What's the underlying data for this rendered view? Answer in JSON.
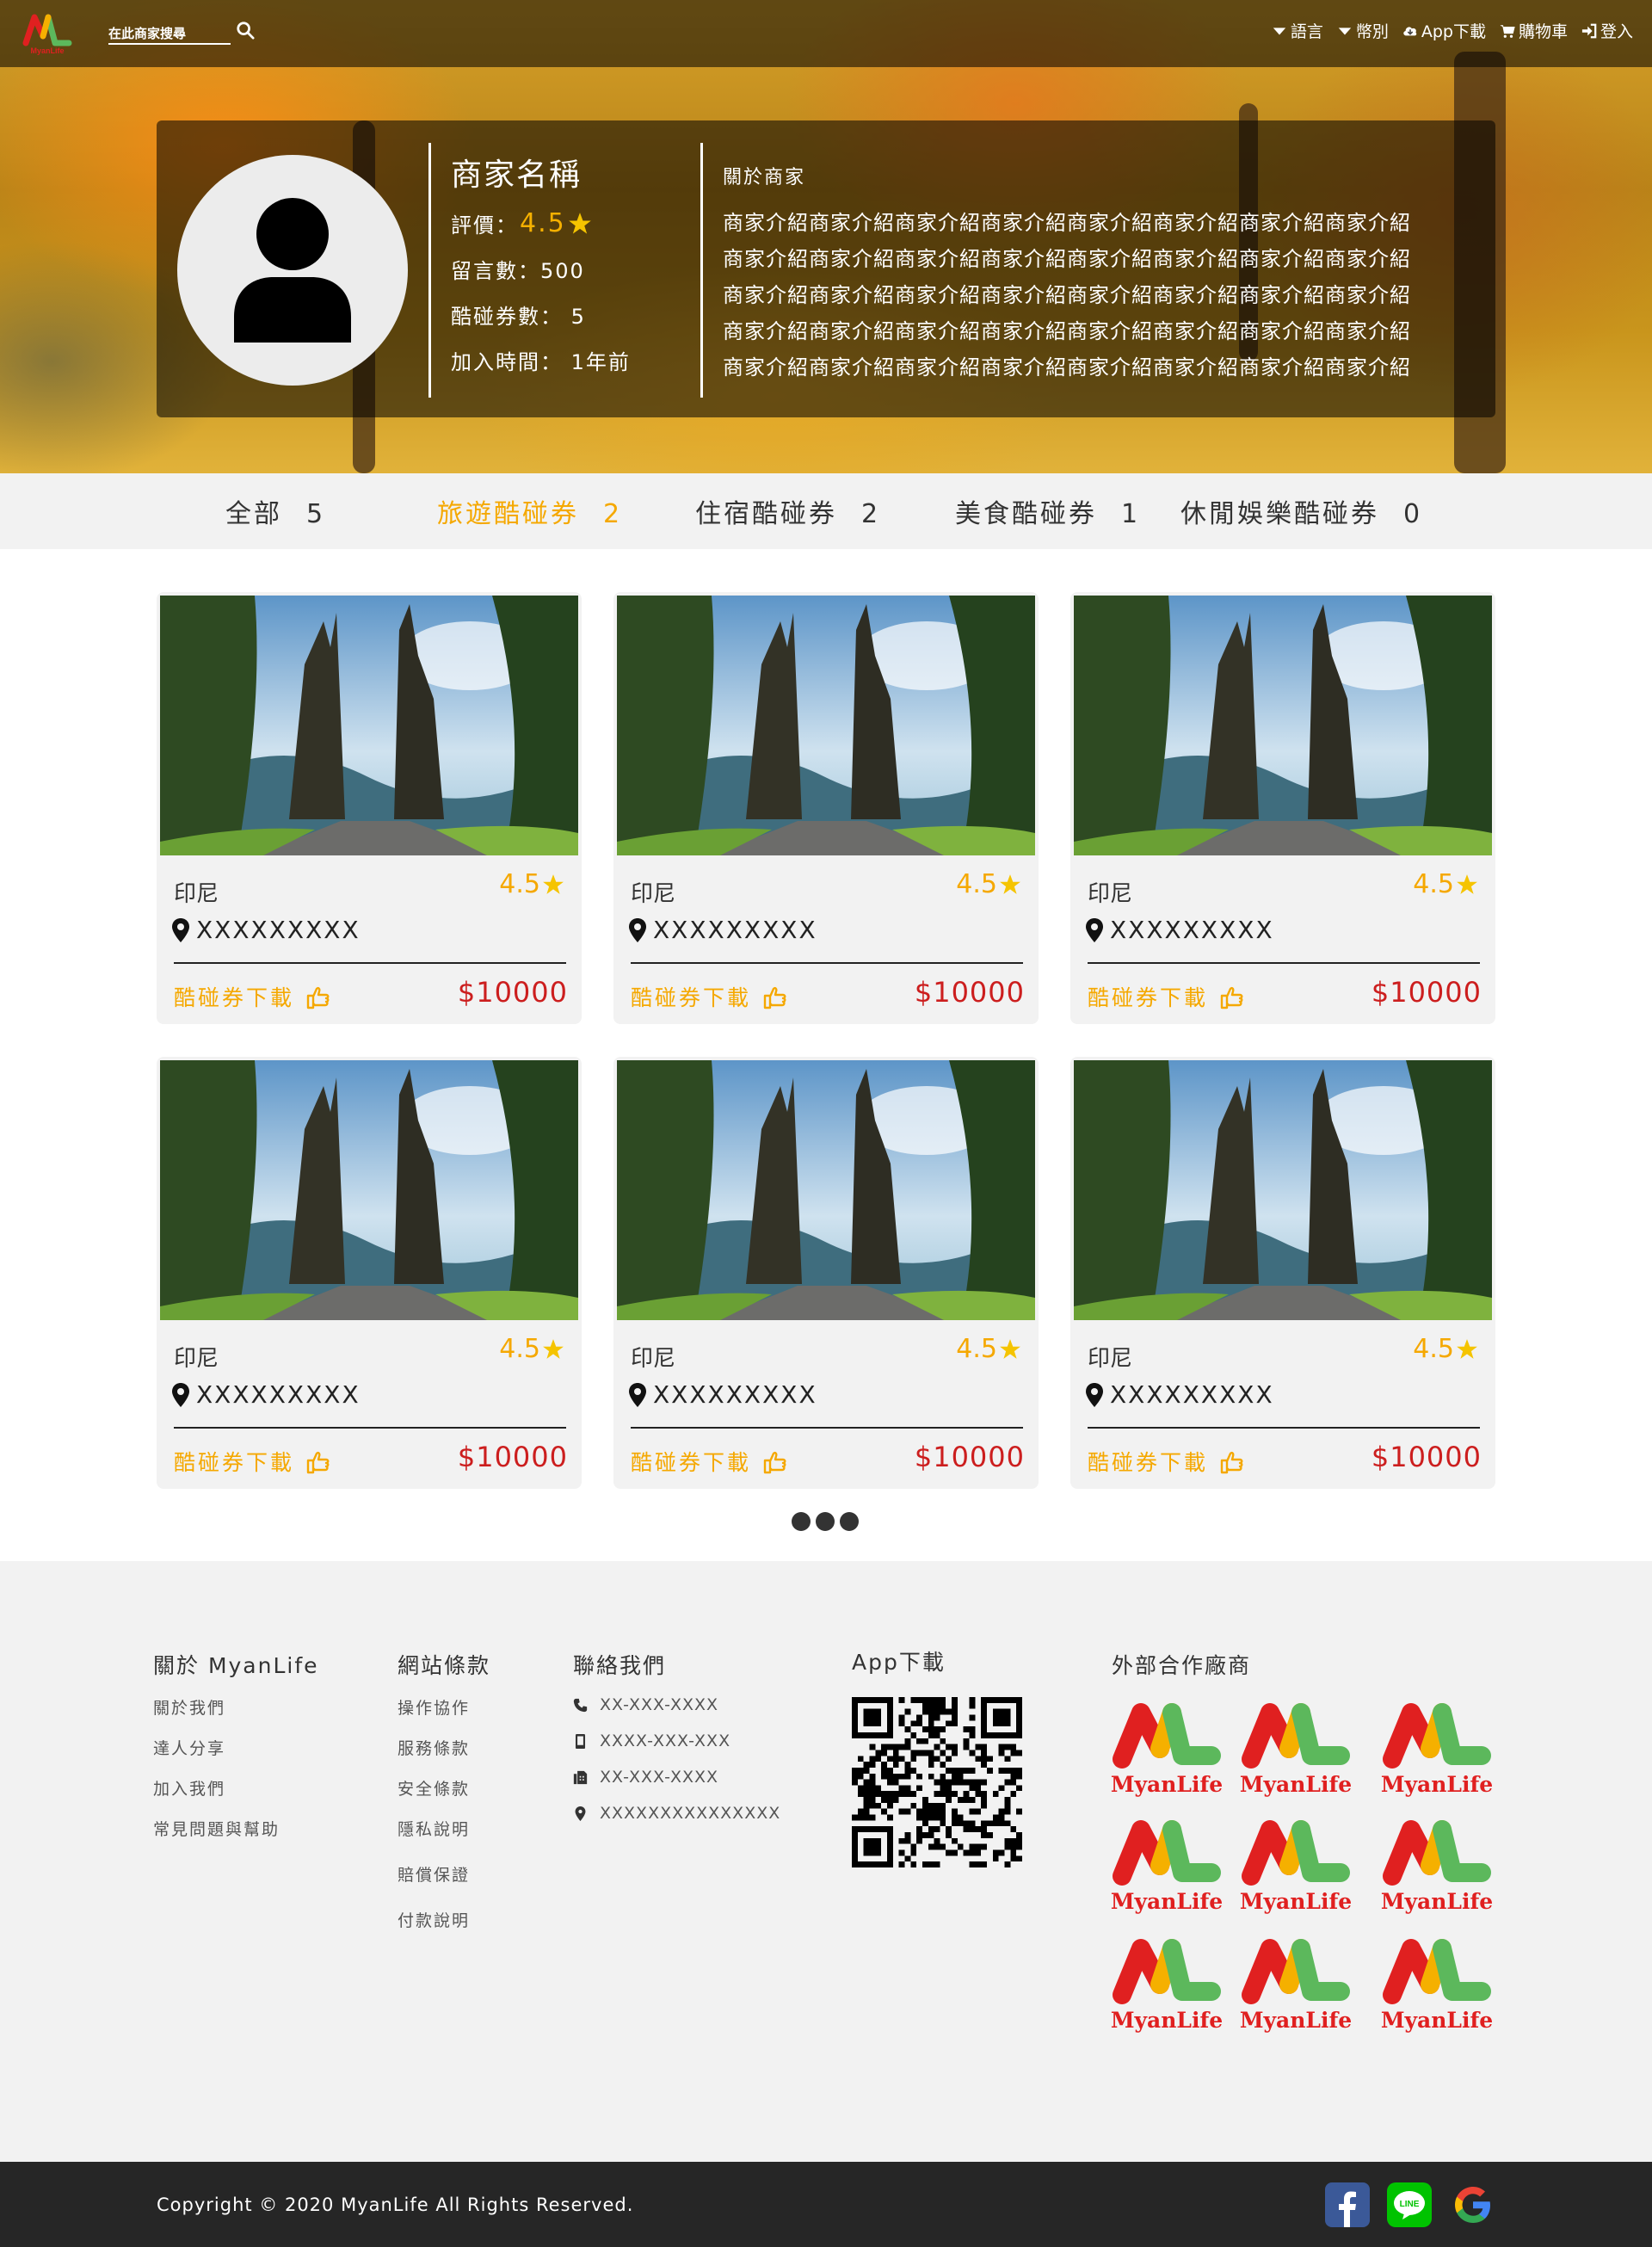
{
  "header": {
    "search_placeholder": "在此商家搜尋",
    "nav": [
      {
        "label": "語言",
        "icon": "caret-down-icon"
      },
      {
        "label": "幣別",
        "icon": "caret-down-icon"
      },
      {
        "label": "App下載",
        "icon": "cloud-download-icon"
      },
      {
        "label": "購物車",
        "icon": "cart-icon"
      },
      {
        "label": "登入",
        "icon": "sign-in-icon"
      }
    ],
    "logo_text": "MyanLife"
  },
  "merchant": {
    "name": "商家名稱",
    "rating_label": "評價：",
    "rating": "4.5",
    "comments": "留言數：500",
    "coupons": "酷碰券數： 5",
    "joined": "加入時間： 1年前",
    "about_title": "關於商家",
    "about_lines": [
      "商家介紹商家介紹商家介紹商家介紹商家介紹商家介紹商家介紹商家介紹",
      "商家介紹商家介紹商家介紹商家介紹商家介紹商家介紹商家介紹商家介紹",
      "商家介紹商家介紹商家介紹商家介紹商家介紹商家介紹商家介紹商家介紹",
      "商家介紹商家介紹商家介紹商家介紹商家介紹商家介紹商家介紹商家介紹",
      "商家介紹商家介紹商家介紹商家介紹商家介紹商家介紹商家介紹商家介紹"
    ]
  },
  "tabs": [
    {
      "label": "全部",
      "count": "5",
      "active": false
    },
    {
      "label": "旅遊酷碰券",
      "count": "2",
      "active": true
    },
    {
      "label": "住宿酷碰券",
      "count": "2",
      "active": false
    },
    {
      "label": "美食酷碰券",
      "count": "1",
      "active": false
    },
    {
      "label": "休閒娛樂酷碰券",
      "count": "0",
      "active": false
    }
  ],
  "cards": [
    {
      "country": "印尼",
      "rating": "4.5",
      "address": "XXXXXXXXX",
      "download": "酷碰券下載",
      "price": "$10000"
    },
    {
      "country": "印尼",
      "rating": "4.5",
      "address": "XXXXXXXXX",
      "download": "酷碰券下載",
      "price": "$10000"
    },
    {
      "country": "印尼",
      "rating": "4.5",
      "address": "XXXXXXXXX",
      "download": "酷碰券下載",
      "price": "$10000"
    },
    {
      "country": "印尼",
      "rating": "4.5",
      "address": "XXXXXXXXX",
      "download": "酷碰券下載",
      "price": "$10000"
    },
    {
      "country": "印尼",
      "rating": "4.5",
      "address": "XXXXXXXXX",
      "download": "酷碰券下載",
      "price": "$10000"
    },
    {
      "country": "印尼",
      "rating": "4.5",
      "address": "XXXXXXXXX",
      "download": "酷碰券下載",
      "price": "$10000"
    }
  ],
  "footer": {
    "about": {
      "title": "關於 MyanLife",
      "links": [
        "關於我們",
        "達人分享",
        "加入我們",
        "常見問題與幫助"
      ]
    },
    "terms": {
      "title": "網站條款",
      "links": [
        "操作協作",
        "服務條款",
        "安全條款",
        "隱私說明",
        "賠償保證",
        "付款說明"
      ]
    },
    "contact": {
      "title": "聯絡我們",
      "items": [
        {
          "icon": "phone-icon",
          "text": "XX-XXX-XXXX"
        },
        {
          "icon": "mobile-icon",
          "text": "XXXX-XXX-XXX"
        },
        {
          "icon": "fax-icon",
          "text": "XX-XXX-XXXX"
        },
        {
          "icon": "map-marker-icon",
          "text": "XXXXXXXXXXXXXXX"
        }
      ]
    },
    "app": {
      "title": "App下載"
    },
    "partners": {
      "title": "外部合作廠商",
      "logo_text": "MyanLife",
      "count": 9
    },
    "copyright": "Copyright © 2020 MyanLife All Rights Reserved."
  },
  "colors": {
    "accent": "#f5a800",
    "price": "#cc1e1e",
    "footer_bg": "#f2f2f2",
    "bottom_bar": "#262626",
    "logo_red": "#e02020",
    "logo_yellow": "#f5b000",
    "logo_green": "#5cb85c"
  }
}
